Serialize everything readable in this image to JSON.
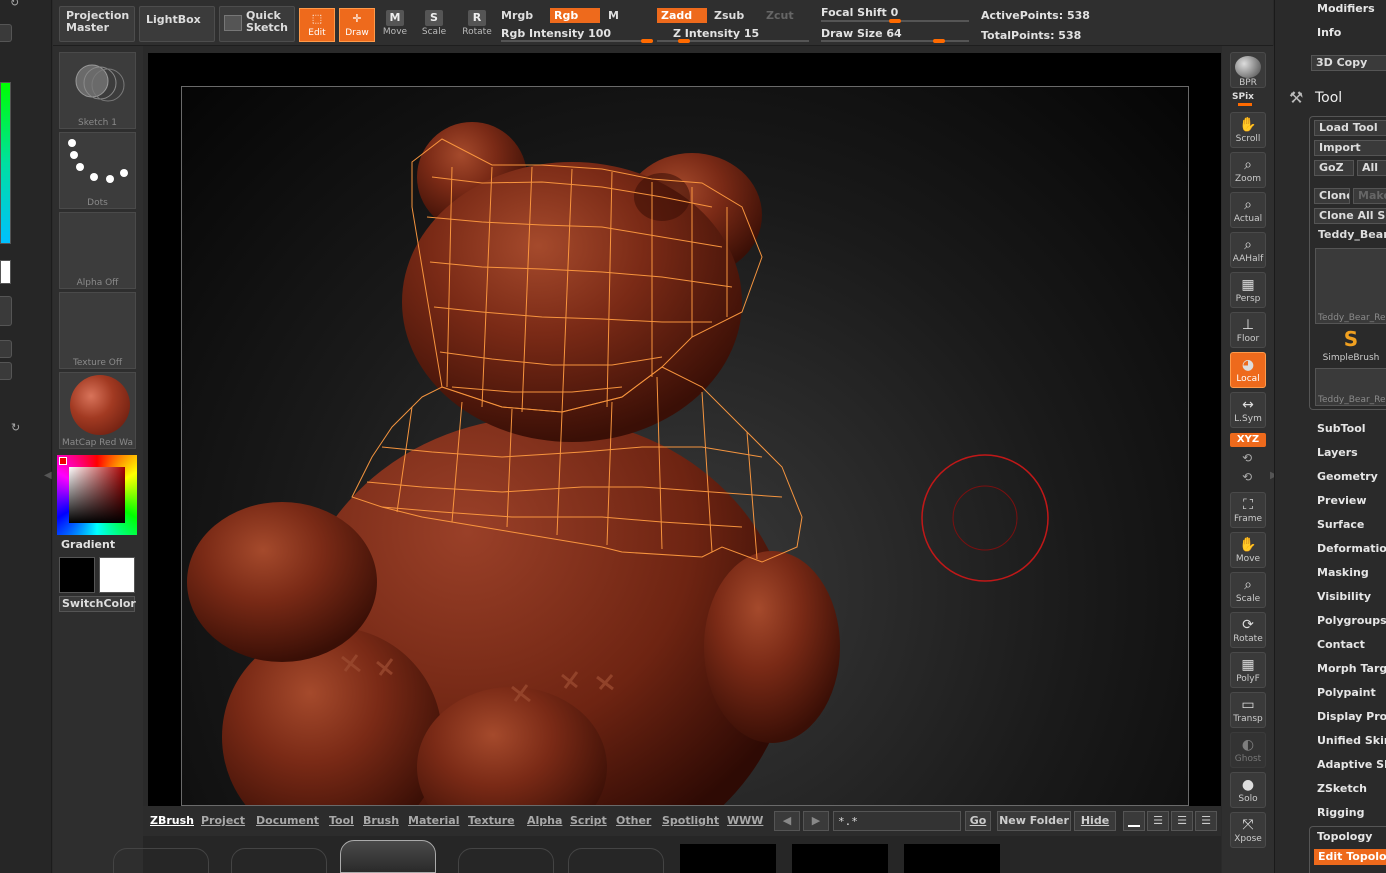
{
  "top": {
    "projection_master": "Projection Master",
    "lightbox": "LightBox",
    "quick_sketch": "Quick Sketch",
    "edit": "Edit",
    "draw": "Draw",
    "move": "Move",
    "scale": "Scale",
    "rotate": "Rotate",
    "mrgb": "Mrgb",
    "rgb": "Rgb",
    "m": "M",
    "zadd": "Zadd",
    "zsub": "Zsub",
    "zcut": "Zcut",
    "rgb_intensity": "Rgb Intensity 100",
    "z_intensity": "Z Intensity 15",
    "focal_shift": "Focal Shift 0",
    "draw_size": "Draw Size 64",
    "active_points": "ActivePoints: 538",
    "total_points": "TotalPoints: 538",
    "rgb_intensity_value": 100,
    "z_intensity_value": 15,
    "focal_shift_value": 0,
    "draw_size_value": 64
  },
  "left": {
    "sketch": "Sketch 1",
    "dots": "Dots",
    "alpha": "Alpha Off",
    "texture": "Texture Off",
    "material": "MatCap Red Wa",
    "gradient": "Gradient",
    "switch_color": "SwitchColor"
  },
  "shelf": {
    "bpr": "BPR",
    "spix": "SPix",
    "scroll": "Scroll",
    "zoom": "Zoom",
    "actual": "Actual",
    "aahalf": "AAHalf",
    "persp": "Persp",
    "floor": "Floor",
    "local": "Local",
    "lsym": "L.Sym",
    "xyz": "XYZ",
    "frame": "Frame",
    "move": "Move",
    "scale": "Scale",
    "rotate": "Rotate",
    "polyf": "PolyF",
    "transp": "Transp",
    "ghost": "Ghost",
    "solo": "Solo",
    "xpose": "Xpose"
  },
  "right": {
    "modifiers": "Modifiers",
    "info": "Info",
    "copy_3d": "3D Copy",
    "tool": "Tool",
    "load_tool": "Load Tool",
    "import": "Import",
    "goz": "GoZ",
    "all": "All",
    "clone": "Clone",
    "make": "Make",
    "clone_all": "Clone All Su",
    "teddy_bear": "Teddy_Bear",
    "teddy_thumb1": "Teddy_Bear_Re",
    "simple_brush": "SimpleBrush",
    "teddy_thumb2": "Teddy_Bear_Re",
    "menus": [
      "SubTool",
      "Layers",
      "Geometry",
      "Preview",
      "Surface",
      "Deformation",
      "Masking",
      "Visibility",
      "Polygroups",
      "Contact",
      "Morph Targe",
      "Polypaint",
      "Display Prop",
      "Unified Skin",
      "Adaptive Sk",
      "ZSketch",
      "Rigging",
      "Topology"
    ],
    "edit_topology": "Edit Topolo"
  },
  "bottom": {
    "menus": [
      "ZBrush",
      "Project",
      "Document",
      "Tool",
      "Brush",
      "Material",
      "Texture",
      "Alpha",
      "Script",
      "Other",
      "Spotlight",
      "WWW"
    ],
    "search_value": "*.*",
    "go": "Go",
    "new_folder": "New Folder",
    "hide": "Hide"
  },
  "colors": {
    "accent": "#ee6a1c",
    "bear_base": "#7a2a16",
    "wireframe": "#ff9a40",
    "brush_ring": "#c01818"
  }
}
